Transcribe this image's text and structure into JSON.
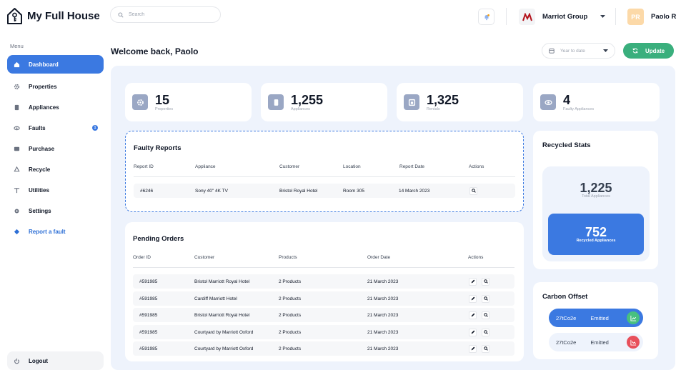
{
  "app": {
    "name": "My Full House"
  },
  "search": {
    "placeholder": "Search"
  },
  "company": {
    "name": "Marriot Group"
  },
  "user": {
    "initials": "PR",
    "name": "Paolo R"
  },
  "sidebar": {
    "menu_label": "Menu",
    "items": [
      {
        "label": "Dashboard",
        "icon": "home-icon"
      },
      {
        "label": "Properties",
        "icon": "gear-icon"
      },
      {
        "label": "Appliances",
        "icon": "appliance-icon"
      },
      {
        "label": "Faults",
        "icon": "eye-icon",
        "badge": "1"
      },
      {
        "label": "Purchase",
        "icon": "card-icon"
      },
      {
        "label": "Recycle",
        "icon": "recycle-icon"
      },
      {
        "label": "Utilities",
        "icon": "utility-icon"
      },
      {
        "label": "Settings",
        "icon": "settings-icon"
      },
      {
        "label": "Report a fault",
        "icon": "diamond-icon"
      }
    ],
    "logout_label": "Logout"
  },
  "main": {
    "welcome": "Welcome back, Paolo",
    "date_filter": "Year to date",
    "update_label": "Update"
  },
  "stats": [
    {
      "value": "15",
      "label": "Properties"
    },
    {
      "value": "1,255",
      "label": "Appliances"
    },
    {
      "value": "1,325",
      "label": "Rentals"
    },
    {
      "value": "4",
      "label": "Faulty Appliances"
    }
  ],
  "faulty_reports": {
    "title": "Faulty Reports",
    "headers": [
      "Report ID",
      "Appliance",
      "Customer",
      "Location",
      "Report Date",
      "Actions"
    ],
    "rows": [
      {
        "id": "#6246",
        "appliance": "Sony 40\" 4K TV",
        "customer": "Bristol Royal Hotel",
        "location": "Room 305",
        "date": "14 March 2023"
      }
    ]
  },
  "pending_orders": {
    "title": "Pending Orders",
    "headers": [
      "Order ID",
      "Customer",
      "Products",
      "Order Date",
      "Actions"
    ],
    "rows": [
      {
        "id": "#591985",
        "customer": "Bristol Marriott Royal Hotel",
        "products": "2 Products",
        "date": "21 March 2023"
      },
      {
        "id": "#591985",
        "customer": "Cardiff Marriott Hotel",
        "products": "2 Products",
        "date": "21 March 2023"
      },
      {
        "id": "#591985",
        "customer": "Bristol Marriott Royal Hotel",
        "products": "2 Products",
        "date": "21 March 2023"
      },
      {
        "id": "#591985",
        "customer": "Courtyard by Marriott Oxford",
        "products": "2 Products",
        "date": "21 March 2023"
      },
      {
        "id": "#591985",
        "customer": "Courtyard by Marriott Oxford",
        "products": "2 Products",
        "date": "21 March 2023"
      }
    ]
  },
  "recycled": {
    "title": "Recycled Stats",
    "total_value": "1,225",
    "total_label": "Total Appliances",
    "recycled_value": "752",
    "recycled_label": "Recycled Appliances"
  },
  "carbon": {
    "title": "Carbon Offset",
    "items": [
      {
        "amount": "27tCo2e",
        "status": "Emitted",
        "trend": "up"
      },
      {
        "amount": "27tCo2e",
        "status": "Emitted",
        "trend": "down"
      }
    ]
  },
  "colors": {
    "accent": "#3b79e1",
    "update": "#3aaf7d",
    "up": "#48c07f",
    "down": "#e8505b"
  }
}
